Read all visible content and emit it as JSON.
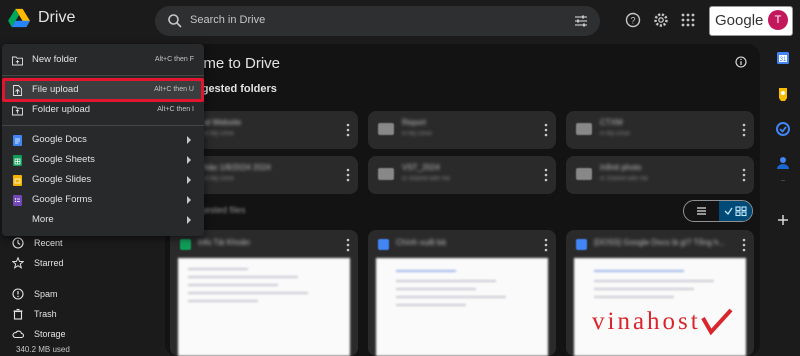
{
  "header": {
    "app_name": "Drive",
    "search_placeholder": "Search in Drive",
    "google_badge": "Google",
    "avatar_initial": "T"
  },
  "new_menu": {
    "items": [
      {
        "label": "New folder",
        "shortcut": "Alt+C then F",
        "icon": "new-folder-icon"
      },
      {
        "label": "File upload",
        "shortcut": "Alt+C then U",
        "icon": "file-upload-icon",
        "active": true
      },
      {
        "label": "Folder upload",
        "shortcut": "Alt+C then I",
        "icon": "folder-upload-icon"
      },
      {
        "label": "Google Docs",
        "icon": "google-docs-icon",
        "color": "#4285f4",
        "submenu": true
      },
      {
        "label": "Google Sheets",
        "icon": "google-sheets-icon",
        "color": "#0f9d58",
        "submenu": true
      },
      {
        "label": "Google Slides",
        "icon": "google-slides-icon",
        "color": "#f4b400",
        "submenu": true
      },
      {
        "label": "Google Forms",
        "icon": "google-forms-icon",
        "color": "#7248b9",
        "submenu": true
      },
      {
        "label": "More",
        "submenu": true
      }
    ],
    "highlight_color": "#e1152e"
  },
  "sidebar": {
    "items": [
      {
        "label": "Recent",
        "icon": "clock-icon"
      },
      {
        "label": "Starred",
        "icon": "star-icon"
      },
      {
        "label": "Spam",
        "icon": "spam-icon"
      },
      {
        "label": "Trash",
        "icon": "trash-icon"
      },
      {
        "label": "Storage",
        "icon": "cloud-icon"
      }
    ],
    "storage_used": "340.2 MB used"
  },
  "main": {
    "welcome_title": "ome to Drive",
    "suggested_folders_label": "ggested folders",
    "suggested_files_label": "ggested files",
    "folders": [
      {
        "name": "al Website",
        "sub": "in My Drive"
      },
      {
        "name": "Report",
        "sub": "in My Drive"
      },
      {
        "name": "CTXM",
        "sub": "in My Drive"
      },
      {
        "name": "hảo 1/8/2024 2024",
        "sub": "in My Drive"
      },
      {
        "name": "VST_2024",
        "sub": "in Shared with me"
      },
      {
        "name": "Infinit photo",
        "sub": "in Shared with me"
      }
    ],
    "files": [
      {
        "name": "Info Tài Khoản",
        "icon_color": "#0f9d58"
      },
      {
        "name": "Chính xuất bà",
        "icon_color": "#4285f4"
      },
      {
        "name": "[DOSS] Google Docs là gì? Tổng h...",
        "icon_color": "#4285f4"
      }
    ]
  },
  "watermark": {
    "text": "vinahost",
    "color": "#d9262c"
  }
}
